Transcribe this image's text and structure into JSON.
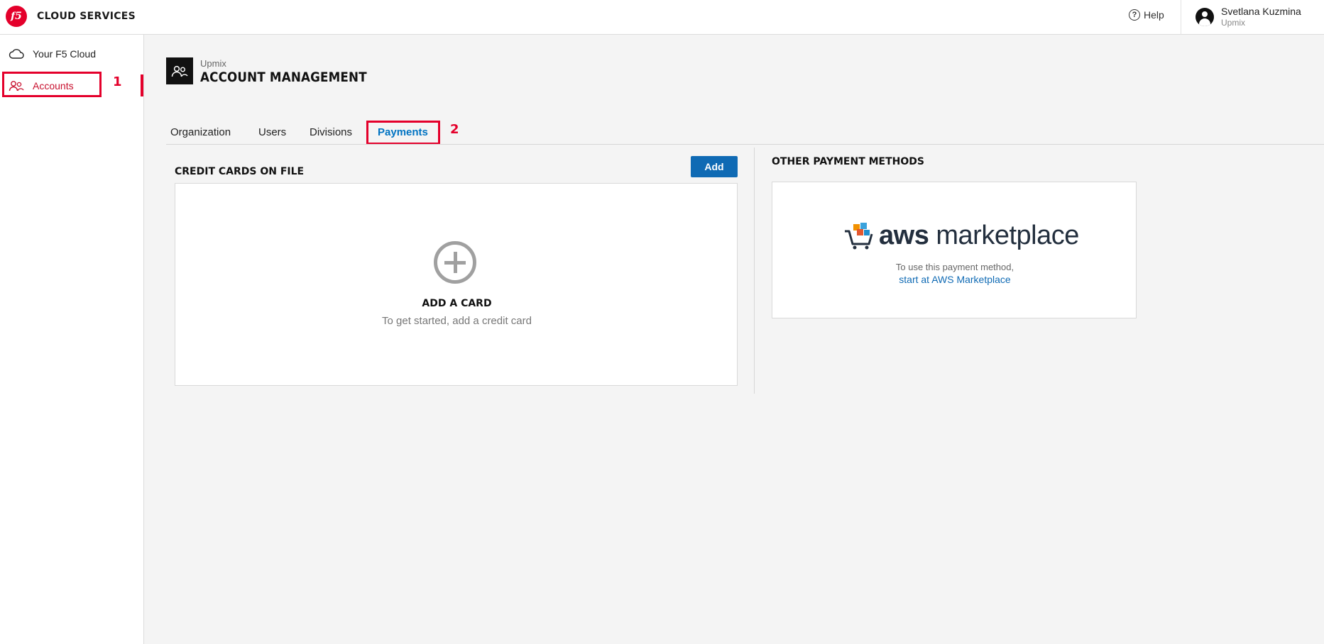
{
  "app": {
    "logo_text": "f5",
    "title": "CLOUD SERVICES"
  },
  "topbar": {
    "help_label": "Help",
    "user_name": "Svetlana Kuzmina",
    "user_org": "Upmix"
  },
  "sidebar": {
    "items": [
      {
        "label": "Your F5 Cloud",
        "icon": "cloud-icon",
        "active": false
      },
      {
        "label": "Accounts",
        "icon": "users-icon",
        "active": true
      }
    ]
  },
  "annotations": {
    "step1": "1",
    "step2": "2",
    "highlight_color": "#e4002b"
  },
  "page": {
    "org": "Upmix",
    "title": "ACCOUNT MANAGEMENT"
  },
  "tabs": [
    {
      "label": "Organization",
      "active": false
    },
    {
      "label": "Users",
      "active": false
    },
    {
      "label": "Divisions",
      "active": false
    },
    {
      "label": "Payments",
      "active": true
    }
  ],
  "credit_cards": {
    "title": "CREDIT CARDS ON FILE",
    "add_button": "Add",
    "empty_title": "ADD A CARD",
    "empty_subtitle": "To get started, add a credit card"
  },
  "other_payments": {
    "title": "OTHER PAYMENT METHODS",
    "provider_bold": "aws",
    "provider_rest": " marketplace",
    "note": "To use this payment method,",
    "link": "start at AWS Marketplace"
  },
  "colors": {
    "accent": "#0f6ab4",
    "brand_red": "#e4002b",
    "active_tab": "#0073c2"
  }
}
